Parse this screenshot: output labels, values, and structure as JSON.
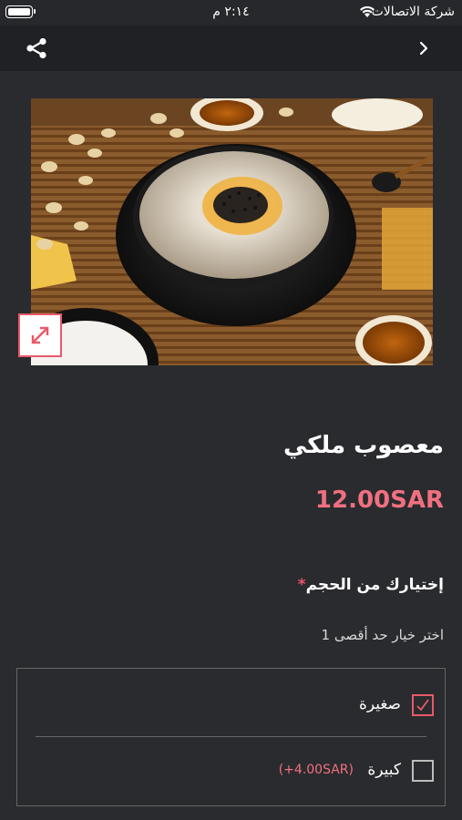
{
  "status": {
    "carrier": "شركة الاتصالات",
    "time": "٢:١٤ م",
    "wifi_icon": "wifi-icon",
    "battery_icon": "battery-icon"
  },
  "nav": {
    "share_icon": "share-icon",
    "back_icon": "chevron-right-icon"
  },
  "product": {
    "image_alt": "معصوب ملكي",
    "expand_icon": "expand-icon",
    "title": "معصوب ملكي",
    "price": "12.00SAR"
  },
  "size": {
    "label": "إختيارك من الحجم",
    "required_mark": "*",
    "hint": "اختر خيار حد أقصى 1",
    "options": [
      {
        "label": "صغيرة",
        "extra": "",
        "checked": true
      },
      {
        "label": "كبيرة",
        "extra": "(+4.00SAR)",
        "checked": false
      }
    ]
  },
  "colors": {
    "background": "#2a2b2e",
    "navbar": "#202124",
    "accent": "#e85a6a",
    "price": "#f07080"
  }
}
